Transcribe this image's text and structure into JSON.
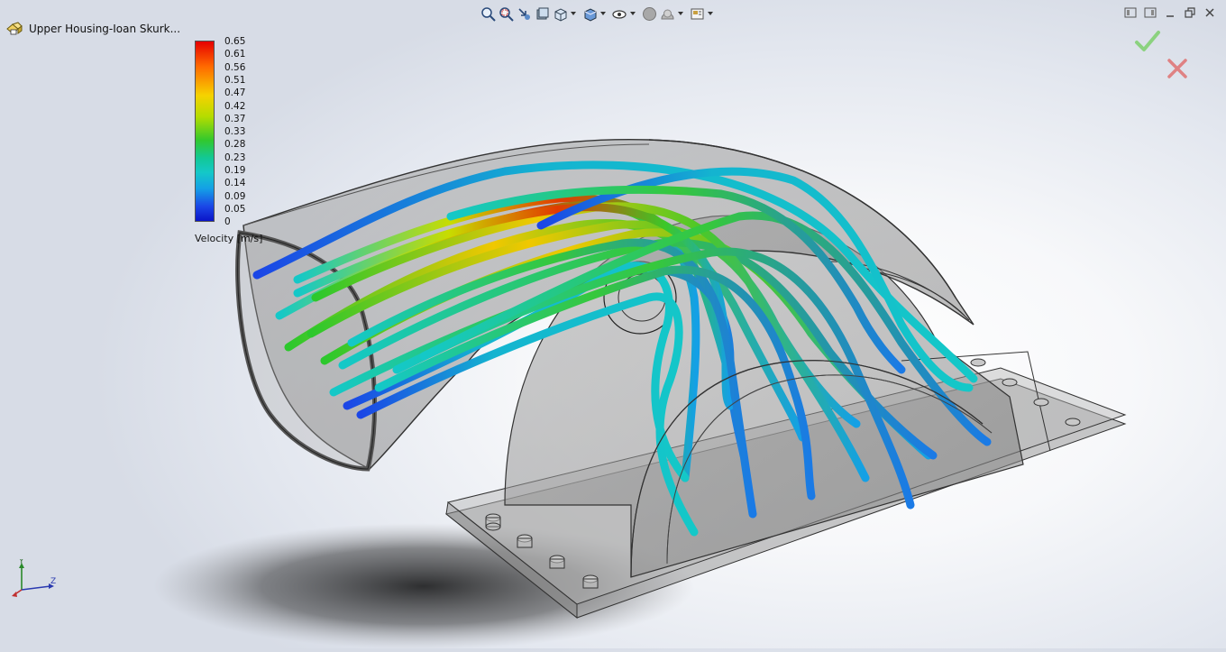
{
  "feature_tree": {
    "part_name": "Upper Housing-Ioan Skurk..."
  },
  "toolbar": {
    "items": [
      {
        "name": "zoom-to-fit-icon"
      },
      {
        "name": "zoom-to-area-icon"
      },
      {
        "name": "previous-view-icon"
      },
      {
        "name": "section-view-icon"
      },
      {
        "name": "view-orientation-icon",
        "dropdown": true
      },
      {
        "name": "display-style-icon",
        "dropdown": true
      },
      {
        "name": "hide-show-items-icon",
        "dropdown": true
      },
      {
        "name": "edit-appearance-icon"
      },
      {
        "name": "apply-scene-icon",
        "dropdown": true
      },
      {
        "name": "view-settings-icon",
        "dropdown": true
      }
    ]
  },
  "legend": {
    "label": "Velocity [m/s]",
    "ticks": [
      "0.65",
      "0.61",
      "0.56",
      "0.51",
      "0.47",
      "0.42",
      "0.37",
      "0.33",
      "0.28",
      "0.23",
      "0.19",
      "0.14",
      "0.09",
      "0.05",
      "0"
    ],
    "colors": {
      "max": "#e60000",
      "mid": "#32c82d",
      "min": "#0a14c8"
    }
  },
  "triad": {
    "x_label": "Z",
    "y_label": "Y"
  },
  "colors": {
    "confirm": "#7ccf6c",
    "cancel": "#e06a6a"
  }
}
